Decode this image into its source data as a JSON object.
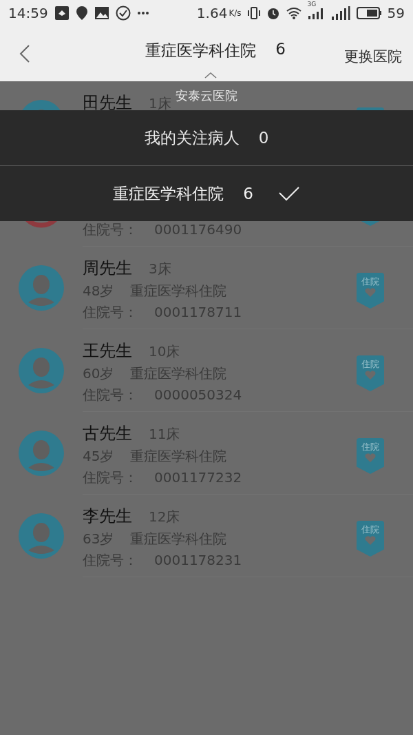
{
  "status_bar": {
    "time": "14:59",
    "speed": "1.64",
    "speed_unit": "K/s",
    "network": "3G",
    "battery": "59"
  },
  "header": {
    "title": "重症医学科住院",
    "count": "6",
    "action": "更换医院"
  },
  "dropdown": {
    "hospital": "安泰云医院",
    "options": [
      {
        "label": "我的关注病人",
        "count": "0",
        "selected": false
      },
      {
        "label": "重症医学科住院",
        "count": "6",
        "selected": true
      }
    ]
  },
  "patients": [
    {
      "name": "田先生",
      "bed": "1床",
      "kind": "male"
    },
    {
      "id_label": "住院号：",
      "id": "0001176490",
      "kind": "female"
    },
    {
      "name": "周先生",
      "bed": "3床",
      "age": "48岁",
      "department": "重症医学科住院",
      "id_label": "住院号：",
      "id": "0001178711",
      "kind": "male",
      "badge": "住院"
    },
    {
      "name": "王先生",
      "bed": "10床",
      "age": "60岁",
      "department": "重症医学科住院",
      "id_label": "住院号：",
      "id": "0000050324",
      "kind": "male",
      "badge": "住院"
    },
    {
      "name": "古先生",
      "bed": "11床",
      "age": "45岁",
      "department": "重症医学科住院",
      "id_label": "住院号：",
      "id": "0001177232",
      "kind": "male",
      "badge": "住院"
    },
    {
      "name": "李先生",
      "bed": "12床",
      "age": "63岁",
      "department": "重症医学科住院",
      "id_label": "住院号：",
      "id": "0001178231",
      "kind": "male",
      "badge": "住院"
    }
  ]
}
